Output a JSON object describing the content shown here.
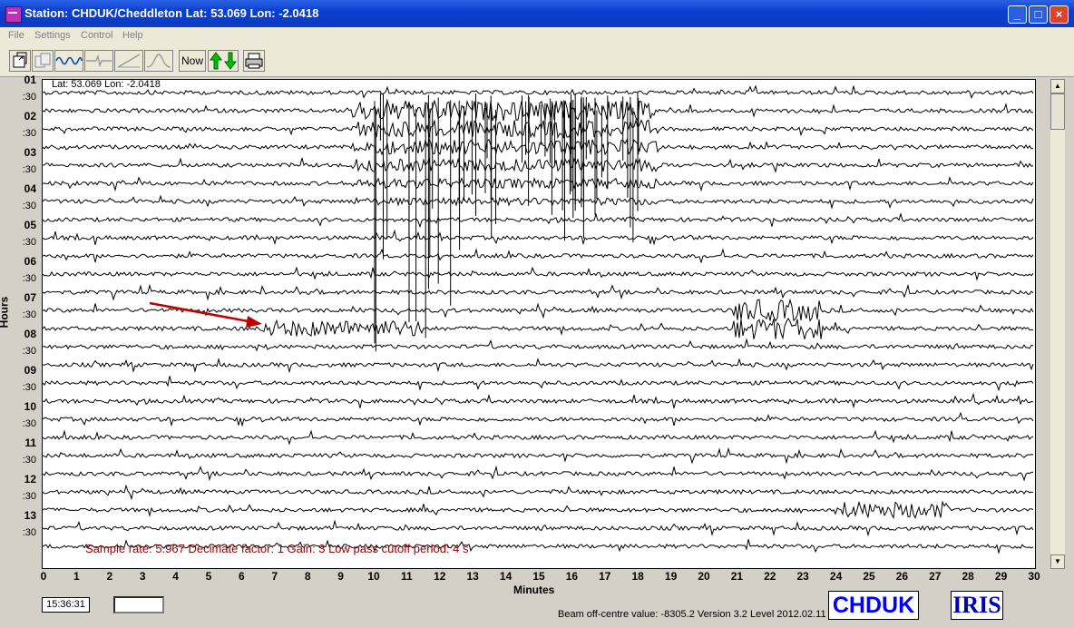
{
  "window": {
    "title": "Station: CHDUK/Cheddleton Lat: 53.069 Lon: -2.0418",
    "min_label": "_",
    "max_label": "□",
    "close_label": "×"
  },
  "menu": [
    "File",
    "Settings",
    "Control",
    "Help"
  ],
  "toolbar": {
    "buttons": [
      "open-icon",
      "copy-icon",
      "wave-icon",
      "flat-trace-icon",
      "ramp-icon",
      "bell-curve-icon"
    ],
    "now_label": "Now",
    "updown_icon": "up-down-arrows-icon",
    "print_icon": "print-icon",
    "updown_color_up": "#00c000",
    "updown_color_down": "#00c000"
  },
  "plot": {
    "latlon": "Lat: 53.069 Lon: -2.0418",
    "y_title": "Hours",
    "y_labels": [
      "01",
      ":30",
      "02",
      ":30",
      "03",
      ":30",
      "04",
      ":30",
      "05",
      ":30",
      "06",
      ":30",
      "07",
      ":30",
      "08",
      ":30",
      "09",
      ":30",
      "10",
      ":30",
      "11",
      ":30",
      "12",
      ":30",
      "13",
      ":30"
    ],
    "x_title": "Minutes",
    "x_labels": [
      "0",
      "1",
      "2",
      "3",
      "4",
      "5",
      "6",
      "7",
      "8",
      "9",
      "10",
      "11",
      "12",
      "13",
      "14",
      "15",
      "16",
      "17",
      "18",
      "19",
      "20",
      "21",
      "22",
      "23",
      "24",
      "25",
      "26",
      "27",
      "28",
      "29",
      "30"
    ],
    "x_range": [
      0,
      30
    ],
    "info_text": "Sample rate: 5.967  Decimate factor: 1  Gain: 3  Low pass cutoff period: 4 s",
    "info_color": "#8b0000",
    "arrow_color": "#c00000",
    "trace_color": "#000000"
  },
  "footer": {
    "time": "15:36:31",
    "blank_field": "",
    "status": "Beam off-centre value: -8305.2  Version 3.2 Level 2012.02.11",
    "logo_chduk": "CHDUK",
    "logo_iris": "IRIS"
  }
}
